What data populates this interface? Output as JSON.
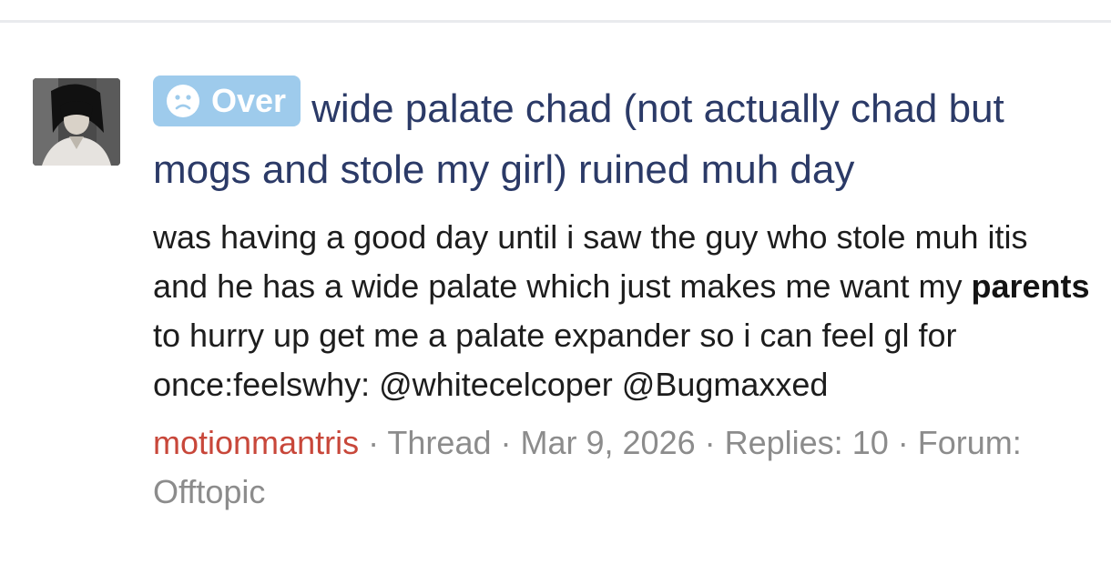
{
  "result": {
    "prefix_label": "Over",
    "prefix_icon": "sad-face-icon",
    "prefix_color": "#9ecbec",
    "title": "wide palate chad (not actually chad but mogs and stole my girl) ruined muh day",
    "snippet": {
      "part1": "was having a good day until i saw the guy who stole muh itis and he has a wide palate which just makes me want my ",
      "highlight": "parents",
      "part2": " to hurry up get me a palate expander so i can feel gl for once:feelswhy: @whitecelcoper @Bugmaxxed"
    },
    "meta": {
      "author": "motionmantris",
      "type": "Thread",
      "date": "Mar 9, 2026",
      "replies": "Replies: 10",
      "forum_label": "Forum:",
      "forum": "Offtopic"
    },
    "colors": {
      "title": "#2b3a67",
      "author": "#c8473a",
      "meta": "#8c8c8c"
    }
  }
}
